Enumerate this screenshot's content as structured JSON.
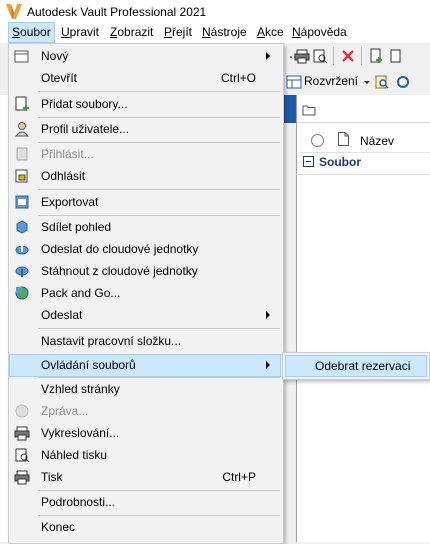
{
  "window": {
    "title": "Autodesk Vault Professional 2021"
  },
  "menubar": [
    {
      "label": "Soubor",
      "accel": "S",
      "rest": "oubor",
      "active": true
    },
    {
      "label": "Upravit",
      "accel": "U",
      "rest": "pravit"
    },
    {
      "label": "Zobrazit",
      "accel": "Z",
      "rest": "obrazit"
    },
    {
      "label": "Přejít",
      "accel": "P",
      "rest": "řejít"
    },
    {
      "label": "Nástroje",
      "accel": "N",
      "rest": "ástroje"
    },
    {
      "label": "Akce",
      "accel": "A",
      "rest": "kce"
    },
    {
      "label": "Nápověda",
      "accel": "N",
      "rest": "ápověda"
    }
  ],
  "toolbar": {
    "layout_label": "Rozvržení"
  },
  "pane": {
    "column_name": "Název",
    "group_label": "Soubor"
  },
  "file_menu": {
    "new": "Nový",
    "open": "Otevřít",
    "open_shortcut": "Ctrl+O",
    "add_files": "Přidat soubory...",
    "user_profile": "Profil uživatele...",
    "login": "Přihlásit...",
    "logout": "Odhlásit",
    "export": "Exportovat",
    "share_view": "Sdílet pohled",
    "send_cloud": "Odeslat do cloudové jednotky",
    "download_cloud": "Stáhnout z cloudové jednotky",
    "pack_go": "Pack and Go...",
    "send": "Odeslat",
    "set_working_folder": "Nastavit pracovní složku...",
    "file_controls": "Ovládání souborů",
    "page_setup": "Vzhled stránky",
    "message": "Zpráva...",
    "plot": "Vykreslování...",
    "print_preview": "Náhled tisku",
    "print": "Tisk",
    "print_shortcut": "Ctrl+P",
    "details": "Podrobnosti...",
    "exit": "Konec"
  },
  "submenu": {
    "undo_checkout": "Odebrat rezervaci"
  }
}
